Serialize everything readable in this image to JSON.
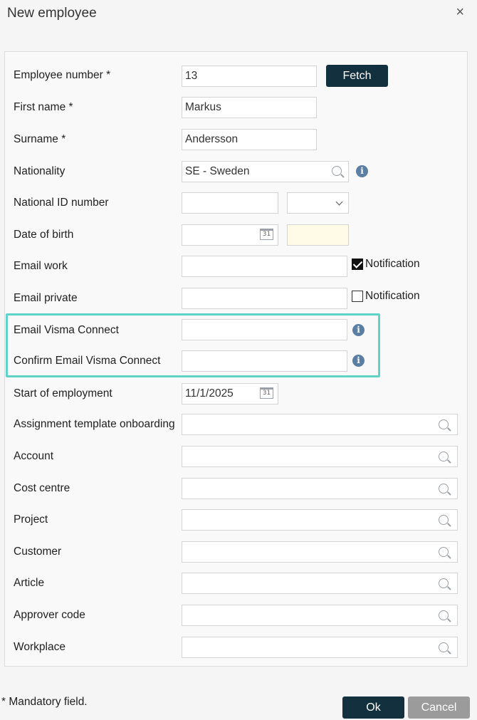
{
  "dialog": {
    "title": "New employee",
    "close_icon": "×"
  },
  "fields": {
    "employee_number": {
      "label": "Employee number *",
      "value": "13"
    },
    "fetch_button": "Fetch",
    "first_name": {
      "label": "First name *",
      "value": "Markus"
    },
    "surname": {
      "label": "Surname *",
      "value": "Andersson"
    },
    "nationality": {
      "label": "Nationality",
      "value": "SE - Sweden"
    },
    "national_id": {
      "label": "National ID number",
      "value": "",
      "select_value": ""
    },
    "date_of_birth": {
      "label": "Date of birth",
      "value": ""
    },
    "email_work": {
      "label": "Email work",
      "value": "",
      "notification_label": "Notification",
      "notification_checked": true
    },
    "email_private": {
      "label": "Email private",
      "value": "",
      "notification_label": "Notification",
      "notification_checked": false
    },
    "email_visma": {
      "label": "Email Visma Connect",
      "value": ""
    },
    "confirm_email_visma": {
      "label": "Confirm Email Visma Connect",
      "value": ""
    },
    "start_of_employment": {
      "label": "Start of employment",
      "value": "11/1/2025"
    },
    "assignment_template": {
      "label": "Assignment template onboarding",
      "value": ""
    },
    "account": {
      "label": "Account",
      "value": ""
    },
    "cost_centre": {
      "label": "Cost centre",
      "value": ""
    },
    "project": {
      "label": "Project",
      "value": ""
    },
    "customer": {
      "label": "Customer",
      "value": ""
    },
    "article": {
      "label": "Article",
      "value": ""
    },
    "approver_code": {
      "label": "Approver code",
      "value": ""
    },
    "workplace": {
      "label": "Workplace",
      "value": ""
    }
  },
  "footer": {
    "mandatory_note": "* Mandatory field.",
    "ok_label": "Ok",
    "cancel_label": "Cancel"
  },
  "icons": {
    "calendar_text": "31",
    "info_text": "i"
  },
  "colors": {
    "primary_button": "#13303f",
    "secondary_button": "#9b9b9b",
    "highlight": "#5fd3c9",
    "info_icon": "#5b7fa3"
  }
}
